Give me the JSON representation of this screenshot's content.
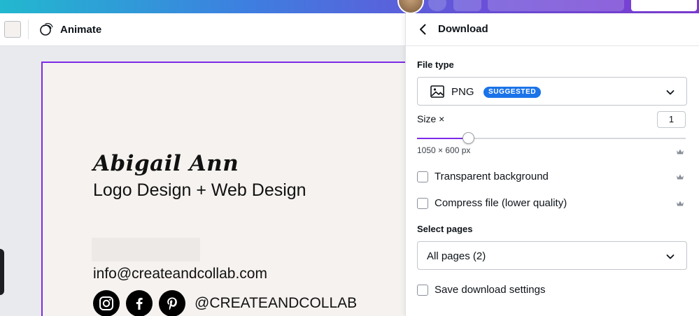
{
  "toolbar": {
    "animate_label": "Animate"
  },
  "card": {
    "name": "Abigail Ann",
    "role": "Logo Design + Web Design",
    "email": "info@createandcollab.com",
    "handle": "@CREATEANDCOLLAB",
    "social_icons": [
      "instagram-icon",
      "facebook-icon",
      "pinterest-icon"
    ]
  },
  "panel": {
    "title": "Download",
    "file_type_label": "File type",
    "file_type_value": "PNG",
    "file_type_badge": "SUGGESTED",
    "size_label": "Size ×",
    "size_value": "1",
    "size_fraction": 0.19,
    "dimensions": "1050 × 600 px",
    "transparent_label": "Transparent background",
    "compress_label": "Compress file (lower quality)",
    "select_pages_label": "Select pages",
    "select_pages_value": "All pages (2)",
    "save_settings_label": "Save download settings"
  },
  "colors": {
    "accent": "#7d2ae8",
    "badge": "#1a73e8"
  }
}
